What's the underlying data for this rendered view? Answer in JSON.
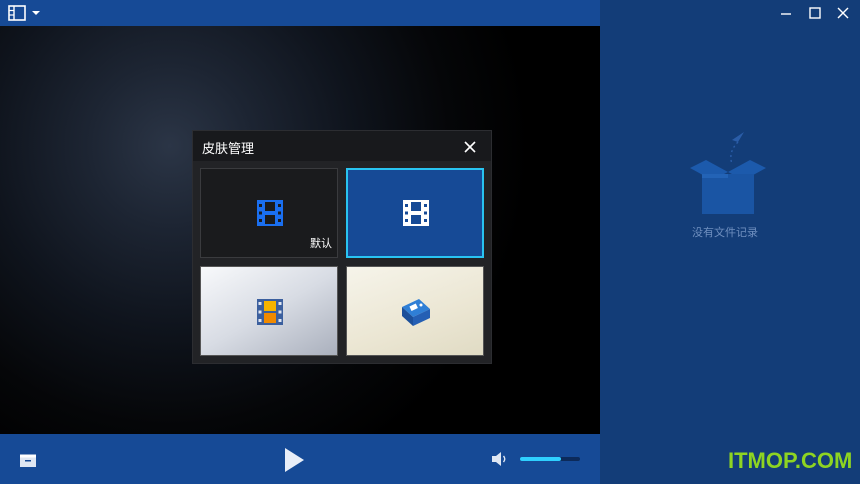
{
  "titlebar": {
    "menu_icon": "film-strip-icon",
    "menu_dropdown": "caret-down-icon"
  },
  "window_controls": [
    "minimize-icon",
    "maximize-icon",
    "close-icon"
  ],
  "dialog": {
    "title": "皮肤管理",
    "close_icon": "close-icon",
    "skins": [
      {
        "label": "默认",
        "icon": "film-strip-icon",
        "selected": false
      },
      {
        "label": "",
        "icon": "film-strip-icon",
        "selected": true
      },
      {
        "label": "",
        "icon": "colorful-film-icon",
        "selected": false
      },
      {
        "label": "",
        "icon": "film-box-icon",
        "selected": false
      }
    ]
  },
  "playlist": {
    "empty_text": "没有文件记录",
    "empty_icon": "empty-box-icon"
  },
  "controls": {
    "open_icon": "open-folder-icon",
    "play_icon": "play-icon",
    "volume_icon": "speaker-icon",
    "volume_level": 0.68
  },
  "watermark": "ITMOP.COM",
  "colors": {
    "bar": "#164a96",
    "panel": "#133d78",
    "accent": "#29c4f2",
    "watermark": "#8ed422"
  }
}
